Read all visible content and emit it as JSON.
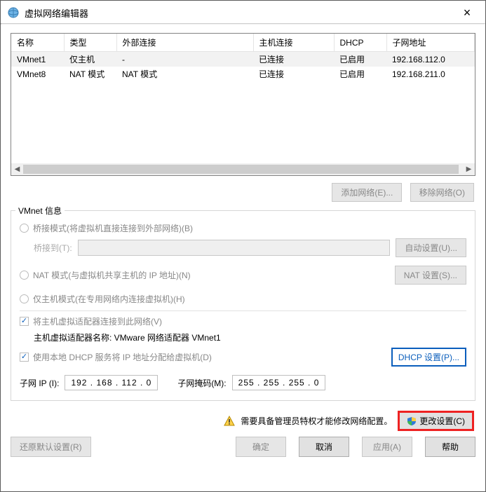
{
  "window": {
    "title": "虚拟网络编辑器"
  },
  "table": {
    "headers": [
      "名称",
      "类型",
      "外部连接",
      "主机连接",
      "DHCP",
      "子网地址"
    ],
    "rows": [
      {
        "name": "VMnet1",
        "type": "仅主机",
        "ext": "-",
        "host": "已连接",
        "dhcp": "已启用",
        "subnet": "192.168.112.0"
      },
      {
        "name": "VMnet8",
        "type": "NAT 模式",
        "ext": "NAT 模式",
        "host": "已连接",
        "dhcp": "已启用",
        "subnet": "192.168.211.0"
      }
    ]
  },
  "buttons": {
    "add_network": "添加网络(E)...",
    "remove_network": "移除网络(O)",
    "auto_settings": "自动设置(U)...",
    "nat_settings": "NAT 设置(S)...",
    "dhcp_settings": "DHCP 设置(P)...",
    "change_settings": "更改设置(C)",
    "restore_defaults": "还原默认设置(R)",
    "ok": "确定",
    "cancel": "取消",
    "apply": "应用(A)",
    "help": "帮助"
  },
  "info": {
    "legend": "VMnet 信息",
    "bridged": "桥接模式(将虚拟机直接连接到外部网络)(B)",
    "bridge_to": "桥接到(T):",
    "nat": "NAT 模式(与虚拟机共享主机的 IP 地址)(N)",
    "hostonly": "仅主机模式(在专用网络内连接虚拟机)(H)",
    "connect_host": "将主机虚拟适配器连接到此网络(V)",
    "adapter_label": "主机虚拟适配器名称: VMware 网络适配器 VMnet1",
    "use_dhcp": "使用本地 DHCP 服务将 IP 地址分配给虚拟机(D)",
    "subnet_ip_label": "子网 IP (I):",
    "subnet_ip": "192 . 168 . 112 .  0",
    "subnet_mask_label": "子网掩码(M):",
    "subnet_mask": "255 . 255 . 255 .  0"
  },
  "admin": {
    "warning": "需要具备管理员特权才能修改网络配置。"
  }
}
